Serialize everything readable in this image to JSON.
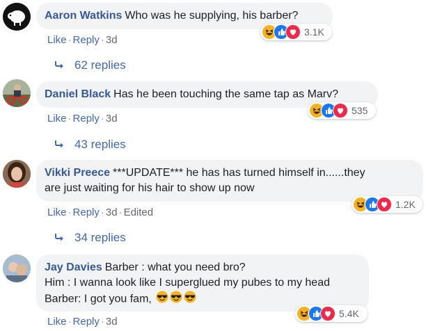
{
  "comments": [
    {
      "author": "Aaron Watkins",
      "lines": [
        "Who was he supplying, his barber?"
      ],
      "reaction_count": "3.1K",
      "actions": {
        "like": "Like",
        "reply": "Reply",
        "time": "3d"
      },
      "replies": "62 replies"
    },
    {
      "author": "Daniel Black",
      "lines": [
        "Has he been touching the same tap as Marv?"
      ],
      "reaction_count": "535",
      "actions": {
        "like": "Like",
        "reply": "Reply",
        "time": "3d"
      },
      "replies": "43 replies"
    },
    {
      "author": "Vikki Preece",
      "lines": [
        "***UPDATE*** he has has turned himself in......they",
        "are just waiting for his hair to show up now"
      ],
      "reaction_count": "1.2K",
      "actions": {
        "like": "Like",
        "reply": "Reply",
        "time": "3d",
        "edited": "Edited"
      },
      "replies": "34 replies"
    },
    {
      "author": "Jay Davies",
      "lines": [
        "Barber : what you need bro?",
        "Him : I wanna look like I superglued my pubes to my head",
        "Barber: I got you fam,"
      ],
      "reaction_count": "5.4K",
      "actions": {
        "like": "Like",
        "reply": "Reply",
        "time": "3d"
      }
    }
  ],
  "icons": {
    "reactions": [
      "haha-icon",
      "like-icon",
      "love-icon"
    ],
    "reply_arrow": "reply-arrow-icon",
    "inline_emoji": "sunglasses-emoji-icon"
  },
  "colors": {
    "author": "#385898",
    "link": "#4267b2",
    "bubble": "#f2f3f5",
    "haha": "#f7b125",
    "like": "#1877f2",
    "love": "#f0284a"
  }
}
